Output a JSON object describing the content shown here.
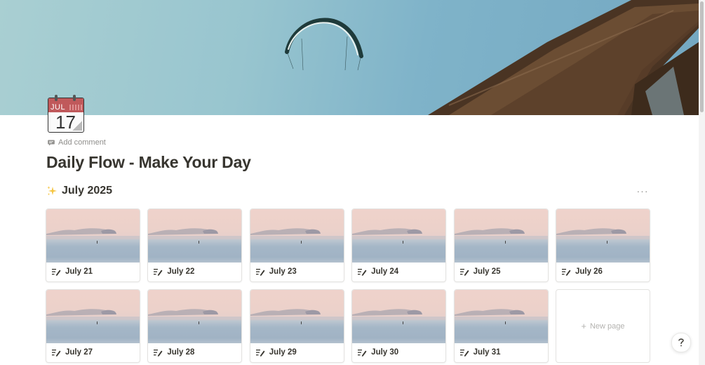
{
  "page": {
    "icon": {
      "name": "calendar-icon",
      "month": "JUL",
      "day": "17"
    },
    "add_comment_label": "Add comment",
    "title": "Daily Flow - Make Your Day"
  },
  "section": {
    "icon": "sparkles-icon",
    "title": "July 2025",
    "more_label": "···"
  },
  "gallery": {
    "cards": [
      {
        "label": "July 21"
      },
      {
        "label": "July 22"
      },
      {
        "label": "July 23"
      },
      {
        "label": "July 24"
      },
      {
        "label": "July 25"
      },
      {
        "label": "July 26"
      },
      {
        "label": "July 27"
      },
      {
        "label": "July 28"
      },
      {
        "label": "July 29"
      },
      {
        "label": "July 30"
      },
      {
        "label": "July 31"
      }
    ],
    "new_page_label": "New page"
  },
  "help": {
    "icon": "help-icon"
  },
  "colors": {
    "text": "#37352f",
    "muted": "#8f8e8b",
    "calendar_red": "#c0595b",
    "sky": "#8fbfcf"
  }
}
